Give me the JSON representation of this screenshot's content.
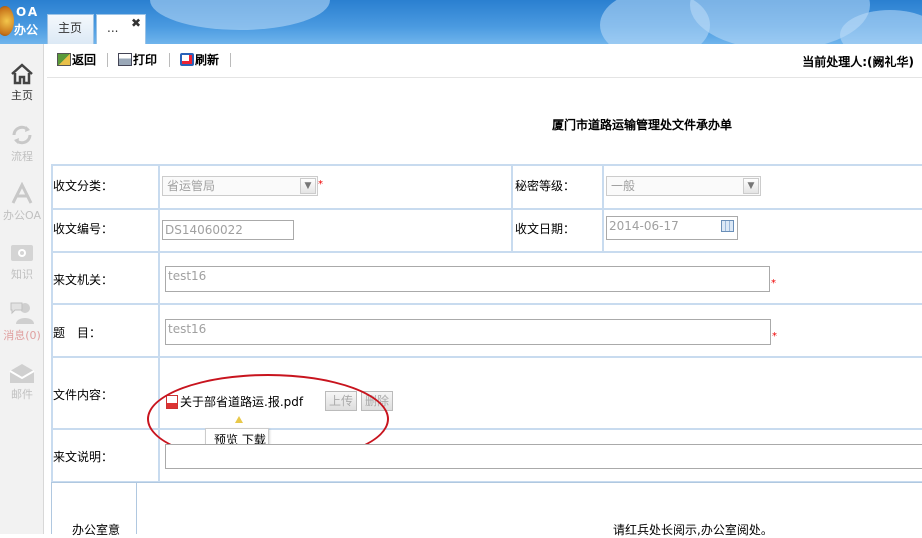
{
  "app": {
    "logo_top": "OA",
    "logo_bottom": "办公"
  },
  "tabs": [
    {
      "label": "主页"
    },
    {
      "label": "..."
    }
  ],
  "sidebar": {
    "items": [
      {
        "label": "主页",
        "icon": "home-icon",
        "active": true
      },
      {
        "label": "流程",
        "icon": "workflow-icon",
        "active": false
      },
      {
        "label": "办公OA",
        "icon": "office-icon",
        "active": false
      },
      {
        "label": "知识",
        "icon": "knowledge-icon",
        "active": false
      },
      {
        "label": "消息(0)",
        "icon": "message-icon",
        "active": false
      },
      {
        "label": "邮件",
        "icon": "mail-icon",
        "active": false
      }
    ]
  },
  "toolbar": {
    "back_label": "返回",
    "print_label": "打印",
    "refresh_label": "刷新",
    "handler": "当前处理人:(阙礼华)"
  },
  "form": {
    "title": "厦门市道路运输管理处文件承办单",
    "category": {
      "label": "收文分类：",
      "value": "省运管局"
    },
    "secret": {
      "label": "秘密等级：",
      "value": "一般"
    },
    "number": {
      "label": "收文编号：",
      "value": "DS14060022"
    },
    "date": {
      "label": "收文日期：",
      "value": "2014-06-17"
    },
    "agency": {
      "label": "来文机关：",
      "value": "test16"
    },
    "subject": {
      "label": "题　目：",
      "value": "test16"
    },
    "content": {
      "label": "文件内容：",
      "attachment": "关于部省道路运.报.pdf",
      "upload_label": "上传",
      "delete_label": "删除",
      "tooltip": "预览 下载"
    },
    "remark": {
      "label": "来文说明："
    },
    "office_opinion": {
      "label": "办公室意",
      "text": "请红兵处长阅示,办公室阅处。"
    },
    "required_mark": "*"
  },
  "colors": {
    "header_blue": "#2a7fd0",
    "table_line": "#c8dbef",
    "annotation_red": "#c8141e",
    "required_red": "#e00000"
  }
}
